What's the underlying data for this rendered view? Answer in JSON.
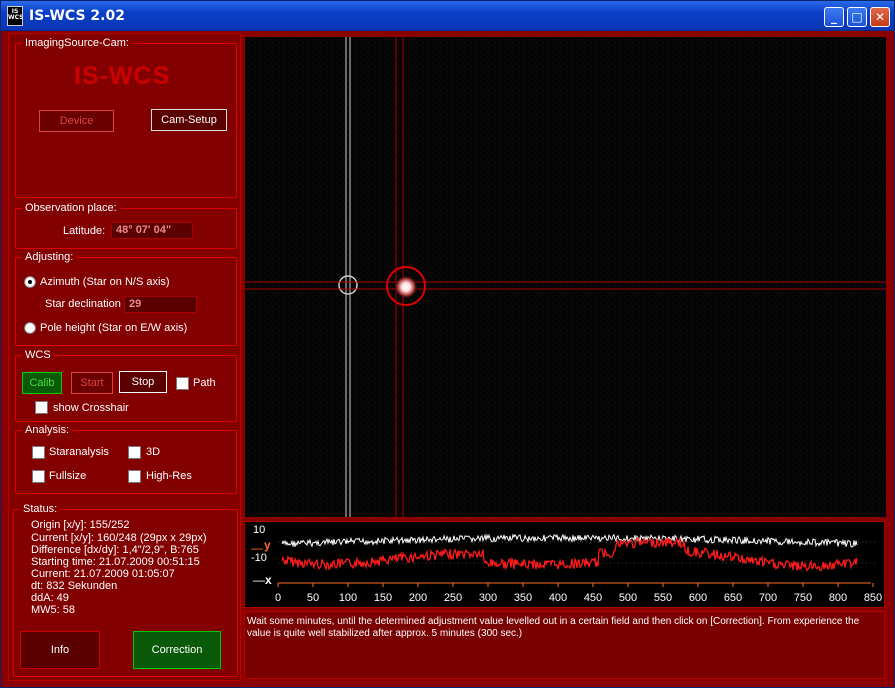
{
  "window": {
    "title": "IS-WCS 2.02",
    "icon_text": "IS WCS",
    "minimize": "_",
    "maximize": "□",
    "close": "✕"
  },
  "camera": {
    "legend": "ImagingSource-Cam:",
    "logo": "IS-WCS",
    "device_button": "Device",
    "setup_button": "Cam-Setup"
  },
  "observation": {
    "legend": "Observation place:",
    "latitude_label": "Latitude:",
    "latitude_value": "48° 07' 04\""
  },
  "adjusting": {
    "legend": "Adjusting:",
    "azimuth_label": "Azimuth (Star on N/S axis)",
    "star_decl_label": "Star declination",
    "star_decl_value": "29",
    "pole_label": "Pole height (Star on E/W axis)"
  },
  "wcs": {
    "legend": "WCS",
    "calib": "Calib",
    "start": "Start",
    "stop": "Stop",
    "path": "Path",
    "crosshair": "show Crosshair"
  },
  "analysis": {
    "legend": "Analysis:",
    "staranalysis": "Staranalysis",
    "three_d": "3D",
    "fullsize": "Fullsize",
    "highres": "High-Res"
  },
  "status": {
    "legend": "Status:",
    "lines": [
      "Origin [x/y]: 155/252",
      "Current [x/y]: 160/248 (29px x 29px)",
      "Difference [dx/dy]: 1,4\"/2,9\", B:765",
      "Starting time: 21.07.2009 00:51:15",
      "Current: 21.07.2009 01:05:07",
      "dt: 832 Sekunden",
      "ddA: 49",
      "MW5: 58"
    ],
    "info_button": "Info",
    "correction_button": "Correction"
  },
  "plot": {
    "y_top": "10",
    "y_label": "y",
    "y_bottom": "-10",
    "x_label": "x",
    "ticks": [
      "0",
      "50",
      "100",
      "150",
      "200",
      "250",
      "300",
      "350",
      "400",
      "450",
      "500",
      "550",
      "600",
      "650",
      "700",
      "750",
      "800",
      "850"
    ]
  },
  "message": "Wait some minutes, until the determined adjustment value levelled out in a certain field and then click on [Correction]. From experience the value is quite well stabilized after approx. 5 minutes (300 sec.)",
  "colors": {
    "accent": "#cc0000",
    "panel": "#830000",
    "trace_y": "#ff1a1a",
    "trace_x": "#ffffff",
    "axis": "#ff6a2a"
  }
}
